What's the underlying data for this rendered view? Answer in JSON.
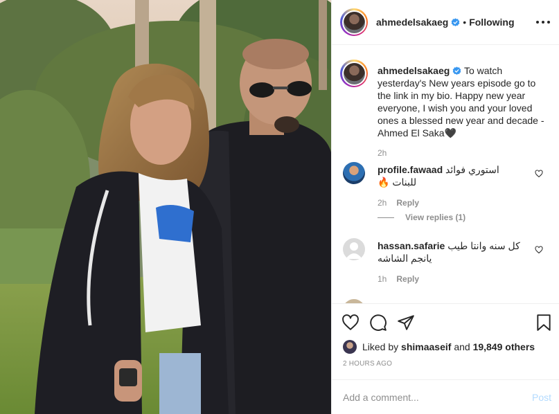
{
  "post_author": {
    "username": "ahmedelsakaeg",
    "verified": true,
    "follow_status": "Following"
  },
  "caption": {
    "username": "ahmedelsakaeg",
    "text": "To watch yesterday's New years episode go to the link in my bio. Happy new year everyone, I wish you and your loved ones a blessed new year and decade - Ahmed El Saka🖤",
    "time": "2h"
  },
  "comments": [
    {
      "username": "profile.fawaad",
      "text": "استوري فوائد للبنات 🔥",
      "time": "2h",
      "reply_label": "Reply",
      "view_replies": "View replies (1)"
    },
    {
      "username": "hassan.safarie",
      "text": "كل سنه وانتا طيب يانجم الشاشه",
      "time": "1h",
      "reply_label": "Reply"
    }
  ],
  "likes": {
    "prefix": "Liked by",
    "first_user": "shimaaseif",
    "connector": "and",
    "others": "19,849 others"
  },
  "post_time": "2 HOURS AGO",
  "comment_box": {
    "placeholder": "Add a comment...",
    "post_label": "Post"
  },
  "colors": {
    "verified_blue": "#3897f0",
    "post_disabled": "#b3dbff",
    "secondary_text": "#8e8e8e"
  }
}
